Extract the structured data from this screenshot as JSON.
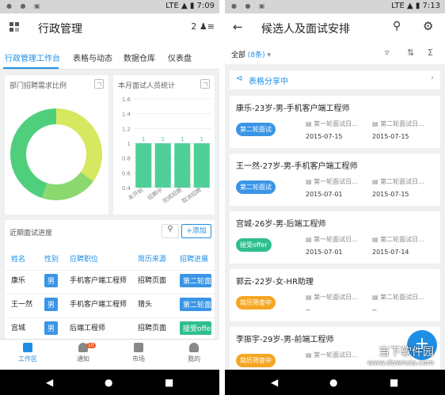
{
  "screen1": {
    "status": {
      "time": "7:09",
      "net": "LTE"
    },
    "title": "行政管理",
    "user_count": "2",
    "tabs": [
      "行政管理工作台",
      "表格与动态",
      "数据仓库",
      "仪表盘"
    ],
    "donut": {
      "title": "部门招聘需求比例"
    },
    "bar_card": {
      "title": "本月面试人员统计"
    },
    "chart_data": [
      {
        "type": "pie",
        "title": "部门招聘需求比例",
        "series": [
          {
            "values": [
              35,
              20,
              45
            ]
          }
        ],
        "colors": [
          "#d6e760",
          "#8bd86f",
          "#4fcf7c"
        ]
      },
      {
        "type": "bar",
        "title": "本月面试人员统计",
        "categories": [
          "未开始",
          "招聘中",
          "完成招聘",
          "取消招聘"
        ],
        "values": [
          1,
          1,
          1,
          1
        ],
        "ylim": [
          0.4,
          1.6
        ],
        "yticks": [
          "1.6",
          "1.4",
          "1.2",
          "1",
          "0.8",
          "0.6",
          "0.4"
        ],
        "color": "#4fcf98"
      }
    ],
    "progress": {
      "title": "近期面试进度",
      "add_label": "+添加",
      "headers": [
        "姓名",
        "性别",
        "应聘职位",
        "简历来源",
        "招聘进展"
      ],
      "rows": [
        {
          "name": "康乐",
          "gender": "男",
          "position": "手机客户端工程师",
          "source": "招聘页面",
          "status": "第二轮面",
          "color": "#3a95e6"
        },
        {
          "name": "王一然",
          "gender": "男",
          "position": "手机客户端工程师",
          "source": "猎头",
          "status": "第二轮面",
          "color": "#3a95e6"
        },
        {
          "name": "宫城",
          "gender": "男",
          "position": "后端工程师",
          "source": "招聘页面",
          "status": "接受offe",
          "color": "#2fbf8f"
        }
      ]
    },
    "nav": [
      {
        "label": "工作区"
      },
      {
        "label": "通知",
        "badge": "10"
      },
      {
        "label": "市场"
      },
      {
        "label": "我的"
      }
    ]
  },
  "screen2": {
    "status": {
      "time": "7:13",
      "net": "LTE"
    },
    "title": "候选人及面试安排",
    "filter_label": "全部",
    "filter_count": "(8条)",
    "share_label": "表格分享中",
    "candidates": [
      {
        "name": "康乐-23岁-男-手机客户端工程师",
        "status": "第二轮面试",
        "color": "#3a95e6",
        "round1": "第一轮面试日...",
        "round2": "第二轮面试日...",
        "date1": "2015-07-15",
        "date2": "2015-07-15"
      },
      {
        "name": "王一然-27岁-男-手机客户端工程师",
        "status": "第二轮面试",
        "color": "#3a95e6",
        "round1": "第一轮面试日...",
        "round2": "第二轮面试日...",
        "date1": "2015-07-01",
        "date2": "2015-07-15"
      },
      {
        "name": "宫城-26岁-男-后端工程师",
        "status": "接受offer",
        "color": "#2fbf8f",
        "round1": "第一轮面试日...",
        "round2": "第二轮面试日...",
        "date1": "2015-07-01",
        "date2": "2015-07-14"
      },
      {
        "name": "郭云-22岁-女-HR助理",
        "status": "简历筛查中",
        "color": "#f5a623",
        "round1": "第一轮面试日...",
        "round2": "第二轮面试日...",
        "date1": "--",
        "date2": "--"
      },
      {
        "name": "李振宇-29岁-男-前端工程师",
        "status": "简历筛查中",
        "color": "#f5a623",
        "round1": "第一轮面试日...",
        "round2": "",
        "date1": "",
        "date2": ""
      }
    ],
    "fab_label": "+",
    "watermark": {
      "line1": "当下软件园",
      "line2": "www.downxia.com"
    }
  }
}
